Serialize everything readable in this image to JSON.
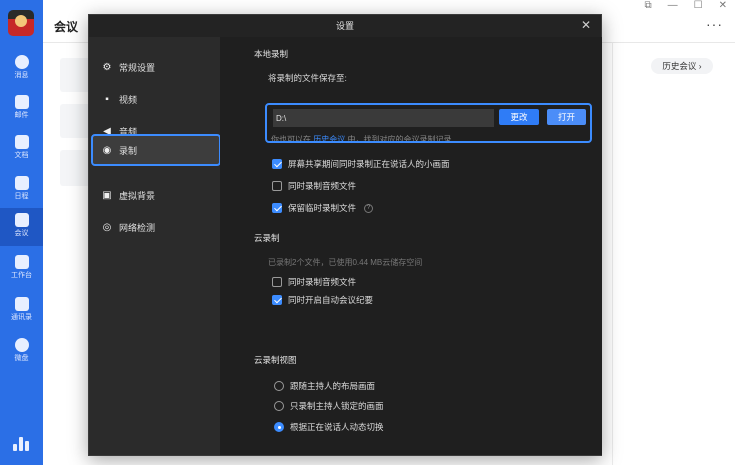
{
  "app": {
    "title": "会议",
    "history_button": "历史会议 ›",
    "more": "···"
  },
  "rail": {
    "items": [
      {
        "label": "消息",
        "icon": "chat-icon"
      },
      {
        "label": "邮件",
        "icon": "mail-icon"
      },
      {
        "label": "文档",
        "icon": "document-icon"
      },
      {
        "label": "日程",
        "icon": "calendar-icon"
      },
      {
        "label": "会议",
        "icon": "meeting-icon"
      },
      {
        "label": "工作台",
        "icon": "workbench-icon"
      },
      {
        "label": "通讯录",
        "icon": "contacts-icon"
      },
      {
        "label": "微盘",
        "icon": "cloud-drive-icon"
      }
    ]
  },
  "dialog": {
    "title": "设置",
    "close": "✕",
    "nav": [
      {
        "label": "常规设置",
        "glyph": "⚙"
      },
      {
        "label": "视频",
        "glyph": "▪"
      },
      {
        "label": "音频",
        "glyph": "◀"
      },
      {
        "label": "录制",
        "glyph": "◉"
      },
      {
        "label": "虚拟背景",
        "glyph": "▣"
      },
      {
        "label": "网络检测",
        "glyph": "◎"
      }
    ],
    "local": {
      "section_title": "本地录制",
      "path_label": "将录制的文件保存至:",
      "path_value": "D:\\",
      "change_button": "更改",
      "open_button": "打开",
      "hint_before": "你也可以在",
      "hint_link": "历史会议",
      "hint_after": "中，找到对应的会议录制记录",
      "options": [
        {
          "label": "屏幕共享期间同时录制正在说话人的小画面",
          "checked": true
        },
        {
          "label": "同时录制音频文件",
          "checked": false
        },
        {
          "label": "保留临时录制文件",
          "checked": true
        }
      ],
      "help_glyph": "?"
    },
    "cloud": {
      "section_title": "云录制",
      "usage_text": "已录制2个文件，已使用0.44 MB云储存空间",
      "options": [
        {
          "label": "同时录制音频文件",
          "checked": false
        },
        {
          "label": "同时开启自动会议纪要",
          "checked": true
        }
      ]
    },
    "cloud_view": {
      "section_title": "云录制视图",
      "options": [
        {
          "label": "跟随主持人的布局画面",
          "selected": false
        },
        {
          "label": "只录制主持人锁定的画面",
          "selected": false
        },
        {
          "label": "根据正在说话人动态切换",
          "selected": true
        }
      ]
    }
  }
}
